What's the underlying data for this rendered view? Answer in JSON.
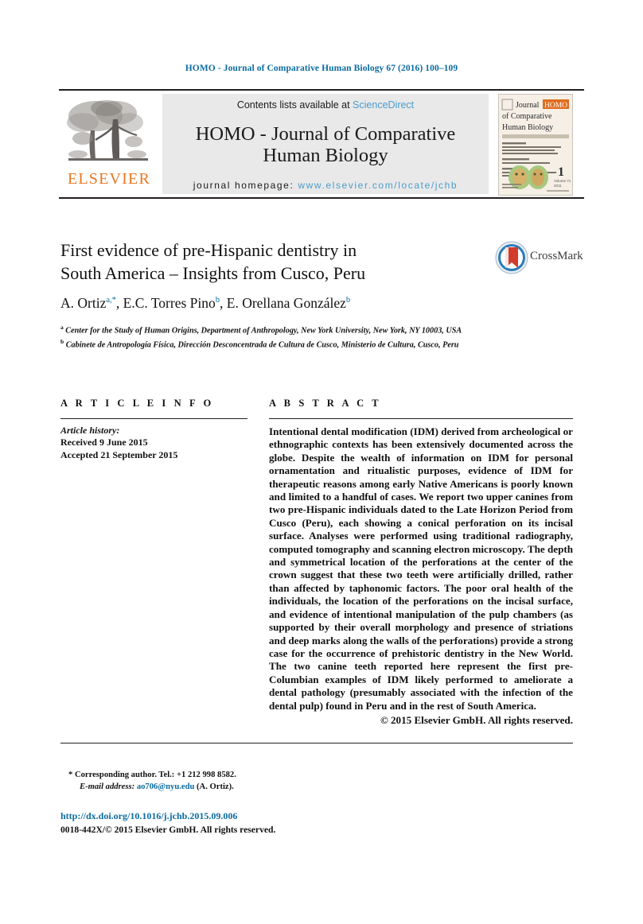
{
  "running_head": "HOMO - Journal of Comparative Human Biology 67 (2016) 100–109",
  "masthead": {
    "contents_prefix": "Contents lists available at ",
    "sciencedirect": "ScienceDirect",
    "journal_title_line1": "HOMO - Journal of Comparative",
    "journal_title_line2": "Human Biology",
    "homepage_label": "journal homepage: ",
    "homepage_url": "www.elsevier.com/locate/jchb",
    "publisher_wordmark": "ELSEVIER",
    "cover": {
      "title_a": "Journal",
      "title_badge": "HOMO",
      "title_b": "of Comparative",
      "title_c": "Human Biology",
      "issue_number": "1",
      "issue_volume": "Volume 71",
      "issue_year": "2011"
    }
  },
  "article": {
    "title_line1": "First evidence of pre-Hispanic dentistry in",
    "title_line2": "South America – Insights from Cusco, Peru",
    "crossmark_label": "CrossMark",
    "authors": [
      {
        "name": "A. Ortiz",
        "marks": "a,*"
      },
      {
        "name": "E.C. Torres Pino",
        "marks": "b"
      },
      {
        "name": "E. Orellana González",
        "marks": "b"
      }
    ],
    "affiliations": [
      {
        "mark": "a",
        "text": "Center for the Study of Human Origins, Department of Anthropology, New York University, New York, NY 10003, USA"
      },
      {
        "mark": "b",
        "text": "Cabinete de Antropología Física, Dirección Desconcentrada de Cultura de Cusco, Ministerio de Cultura, Cusco, Peru"
      }
    ]
  },
  "article_info": {
    "heading": "A R T I C L E   I N F O",
    "history_label": "Article history:",
    "received": "Received 9 June 2015",
    "accepted": "Accepted 21 September 2015"
  },
  "abstract": {
    "heading": "A B S T R A C T",
    "body": "Intentional dental modification (IDM) derived from archeological or ethnographic contexts has been extensively documented across the globe. Despite the wealth of information on IDM for personal ornamentation and ritualistic purposes, evidence of IDM for therapeutic reasons among early Native Americans is poorly known and limited to a handful of cases. We report two upper canines from two pre-Hispanic individuals dated to the Late Horizon Period from Cusco (Peru), each showing a conical perforation on its incisal surface. Analyses were performed using traditional radiography, computed tomography and scanning electron microscopy. The depth and symmetrical location of the perforations at the center of the crown suggest that these two teeth were artificially drilled, rather than affected by taphonomic factors. The poor oral health of the individuals, the location of the perforations on the incisal surface, and evidence of intentional manipulation of the pulp chambers (as supported by their overall morphology and presence of striations and deep marks along the walls of the perforations) provide a strong case for the occurrence of prehistoric dentistry in the New World. The two canine teeth reported here represent the first pre-Columbian examples of IDM likely performed to ameliorate a dental pathology (presumably associated with the infection of the dental pulp) found in Peru and in the rest of South America.",
    "copyright": "© 2015 Elsevier GmbH. All rights reserved."
  },
  "footer": {
    "corresponding": "* Corresponding author. Tel.: +1 212 998 8582.",
    "email_label": "E-mail address: ",
    "email": "ao706@nyu.edu",
    "email_suffix": " (A. Ortiz).",
    "doi": "http://dx.doi.org/10.1016/j.jchb.2015.09.006",
    "issn": "0018-442X/© 2015 Elsevier GmbH. All rights reserved."
  },
  "colors": {
    "link_blue": "#0b6ba0",
    "sciencedirect_blue": "#4a9ccc",
    "elsevier_orange": "#e87722",
    "rule_black": "#231f20"
  }
}
